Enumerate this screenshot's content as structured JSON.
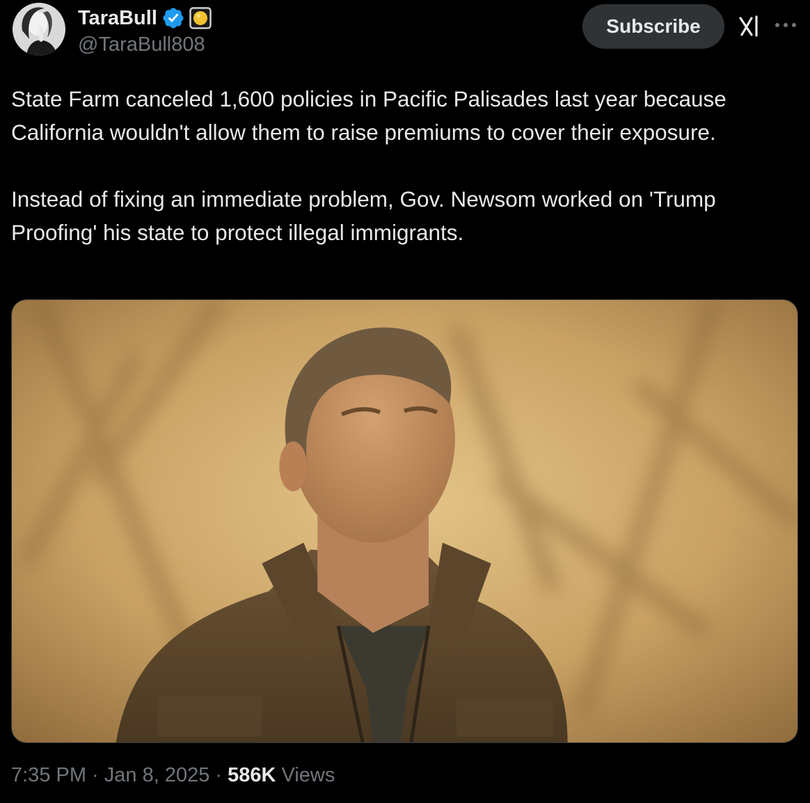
{
  "author": {
    "display_name": "TaraBull",
    "handle": "@TaraBull808"
  },
  "header": {
    "subscribe_label": "Subscribe"
  },
  "post": {
    "paragraphs": [
      "State Farm canceled 1,600 policies in Pacific Palisades last year because California wouldn't allow them to raise premiums to cover their exposure.",
      "Instead of fixing an immediate problem, Gov. Newsom worked on 'Trump Proofing' his state to protect illegal immigrants."
    ]
  },
  "meta": {
    "time": "7:35 PM",
    "separator": " · ",
    "date": "Jan 8, 2025",
    "views_count": "586K",
    "views_label": "Views"
  },
  "icons": {
    "verified": "verified-badge-icon",
    "affiliate": "yellow-circle-badge-icon",
    "grok": "grok-icon",
    "more": "more-horizontal-icon"
  },
  "colors": {
    "background": "#000000",
    "text_primary": "#e7e9ea",
    "text_secondary": "#71767b",
    "verified_blue": "#1d9bf0",
    "button_bg": "#2f3336"
  }
}
